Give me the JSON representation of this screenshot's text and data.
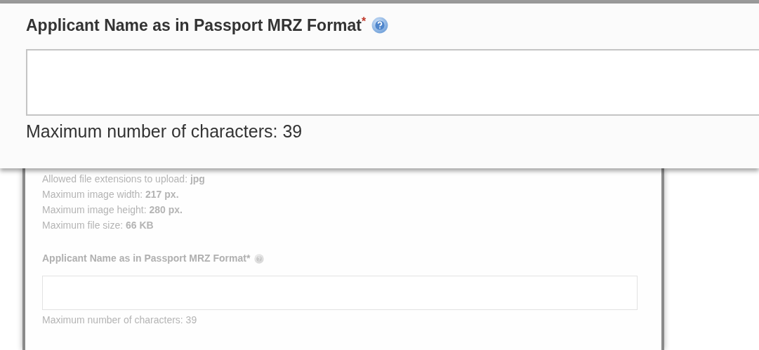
{
  "magnified_field": {
    "label": "Applicant Name as in Passport MRZ Format",
    "required_mark": "*",
    "hint": "Maximum number of characters: 39"
  },
  "form": {
    "photo_rules": [
      "Allowed file extensions to upload: **jpg**",
      "Maximum image width: **217 px.**",
      "Maximum image height: **280 px.**",
      "Maximum file size: **66 KB**"
    ],
    "field": {
      "label": "Applicant Name as in Passport MRZ Format",
      "required_mark": "*",
      "hint": "Maximum number of characters: 39"
    }
  }
}
